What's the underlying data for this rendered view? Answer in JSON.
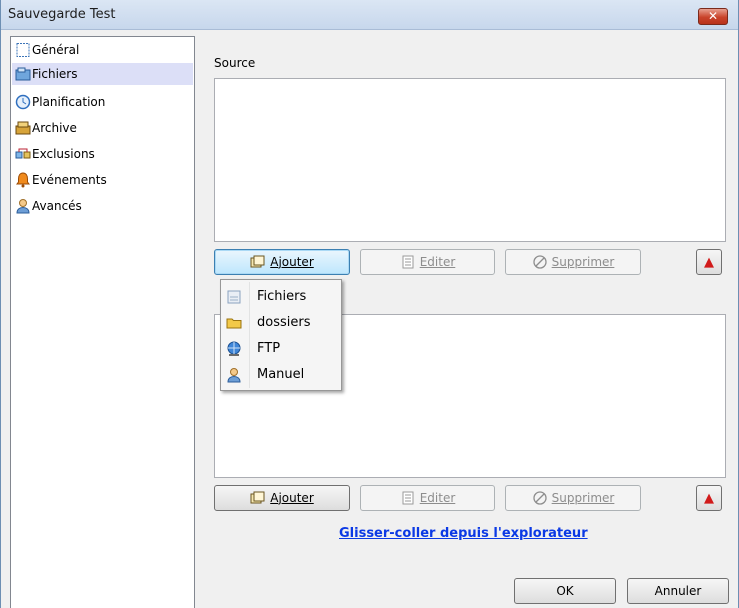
{
  "window": {
    "title": "Sauvegarde Test",
    "close_symbol": "✕"
  },
  "sidebar": {
    "items": [
      {
        "label": "Général",
        "icon": "general-icon"
      },
      {
        "label": "Fichiers",
        "icon": "files-icon",
        "selected": true
      },
      {
        "label": "Planification",
        "icon": "clock-icon"
      },
      {
        "label": "Archive",
        "icon": "archive-icon"
      },
      {
        "label": "Exclusions",
        "icon": "exclusions-icon"
      },
      {
        "label": "Evénements",
        "icon": "bell-icon"
      },
      {
        "label": "Avancés",
        "icon": "user-icon"
      }
    ]
  },
  "source": {
    "label": "Source",
    "buttons": {
      "add": "Ajouter",
      "edit": "Editer",
      "delete": "Supprimer",
      "up_symbol": "▲"
    }
  },
  "destination": {
    "buttons": {
      "add": "Ajouter",
      "edit": "Editer",
      "delete": "Supprimer",
      "up_symbol": "▲"
    }
  },
  "add_menu": {
    "items": [
      {
        "label": "Fichiers",
        "icon": "file-icon"
      },
      {
        "label": "dossiers",
        "icon": "folder-icon"
      },
      {
        "label": "FTP",
        "icon": "ftp-globe-icon"
      },
      {
        "label": "Manuel",
        "icon": "manual-user-icon"
      }
    ]
  },
  "drag_drop_link": "Glisser-coller depuis l'explorateur",
  "footer": {
    "ok": "OK",
    "cancel": "Annuler"
  },
  "colors": {
    "selection": "#dcdff7",
    "link": "#0b39e5",
    "up_arrow": "#d11a1a"
  }
}
